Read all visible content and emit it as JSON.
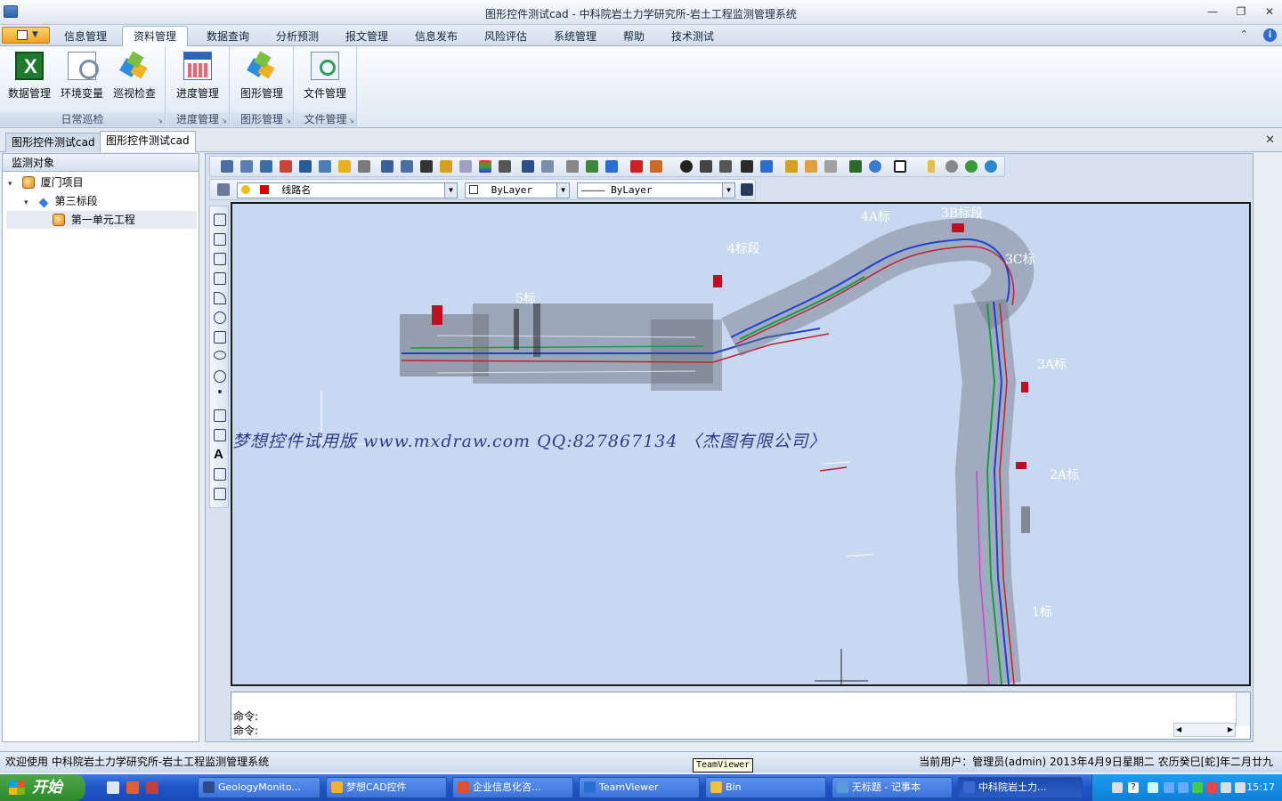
{
  "window": {
    "title": "图形控件测试cad - 中科院岩土力学研究所-岩土工程监测管理系统",
    "controls": [
      "—",
      "❐",
      "✕"
    ]
  },
  "menu": {
    "tabs": [
      "信息管理",
      "资料管理",
      "数据查询",
      "分析预测",
      "报文管理",
      "信息发布",
      "风险评估",
      "系统管理",
      "帮助",
      "技术测试"
    ],
    "active_tab": "资料管理",
    "caret": "⌃",
    "help": "i"
  },
  "ribbon": {
    "groups": [
      {
        "title": "日常巡检",
        "buttons": [
          "数据管理",
          "环境变量",
          "巡视检查"
        ]
      },
      {
        "title": "进度管理",
        "buttons": [
          "进度管理"
        ]
      },
      {
        "title": "图形管理",
        "buttons": [
          "图形管理"
        ]
      },
      {
        "title": "文件管理",
        "buttons": [
          "文件管理"
        ]
      }
    ],
    "launcher": "↘"
  },
  "doc_tabs": {
    "tabs": [
      "图形控件测试cad",
      "图形控件测试cad"
    ],
    "active_index": 1,
    "close": "✕"
  },
  "tree": {
    "header": "监测对象",
    "nodes": [
      {
        "label": "厦门项目",
        "twisty": "▾"
      },
      {
        "label": "第三标段",
        "twisty": "▾"
      },
      {
        "label": "第一单元工程",
        "twisty": ""
      }
    ]
  },
  "cad": {
    "layer_combo": "线路名",
    "color_combo": "ByLayer",
    "linetype_combo": "———— ByLayer",
    "dd_arrow": "▼",
    "labels": [
      "4A标",
      "3B标段",
      "4标段",
      "3C标",
      "5标",
      "3A标",
      "2A标",
      "1标"
    ],
    "watermark": "梦想控件试用版  www.mxdraw.com  QQ:827867134 〈杰图有限公司〉",
    "command_lines": [
      "命令:",
      "命令:"
    ],
    "scroll_left": "◀",
    "scroll_right": "▶"
  },
  "status": {
    "left": "欢迎使用 中科院岩土力学研究所-岩土工程监测管理系统",
    "right": "当前用户：管理员(admin)  2013年4月9日星期二 农历癸巳[蛇]年二月廿九"
  },
  "tooltip": "TeamViewer",
  "taskbar": {
    "start": "开始",
    "tasks": [
      "GeologyMonito...",
      "梦想CAD控件",
      "企业信息化咨...",
      "TeamViewer",
      "Bin",
      "无标题 - 记事本",
      "中科院岩土力..."
    ],
    "active_task_index": 6,
    "clock": "15:17"
  }
}
